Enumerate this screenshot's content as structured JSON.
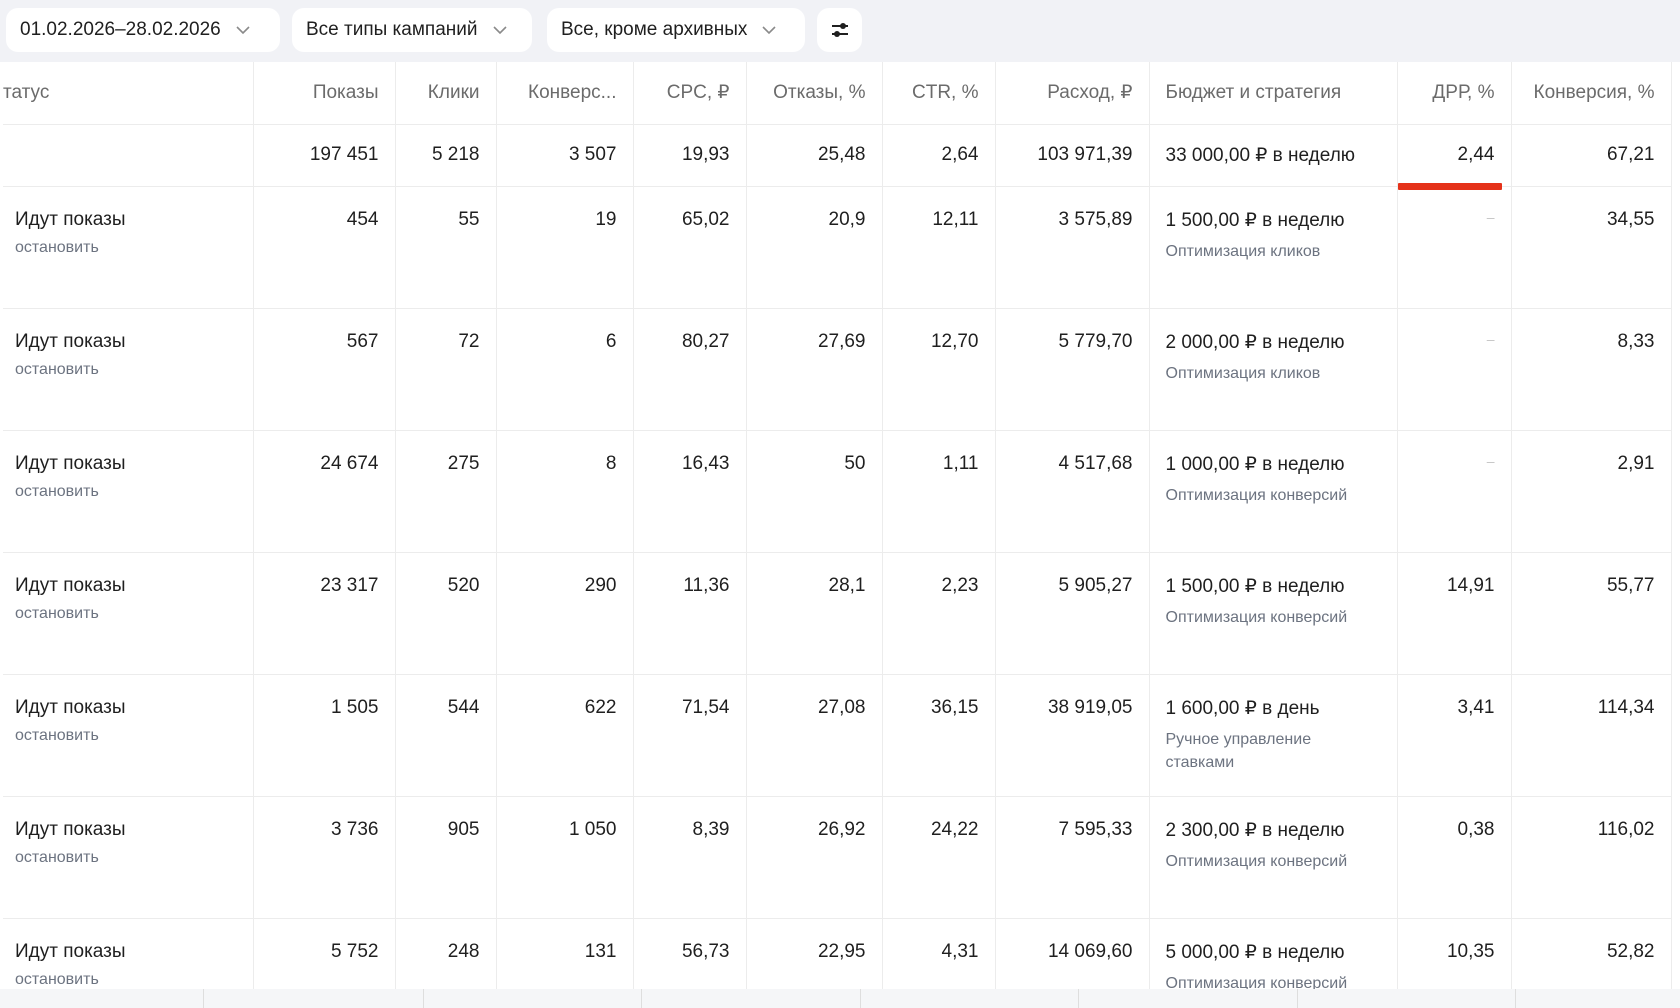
{
  "filters": {
    "date_range": "01.02.2026–28.02.2026",
    "campaign_types": "Все типы кампаний",
    "archive_filter": "Все, кроме архивных"
  },
  "columns": [
    "татус",
    "Показы",
    "Клики",
    "Конверс...",
    "CPC, ₽",
    "Отказы, %",
    "CTR, %",
    "Расход, ₽",
    "Бюджет и стратегия",
    "ДРР, %",
    "Конверсия, %"
  ],
  "totals": {
    "impressions": "197 451",
    "clicks": "5 218",
    "conversions": "3 507",
    "cpc": "19,93",
    "bounces": "25,48",
    "ctr": "2,64",
    "spend": "103 971,39",
    "budget": "33 000,00 ₽ в неделю",
    "drr": "2,44",
    "conv_rate": "67,21"
  },
  "rows": [
    {
      "status": "Идут показы",
      "action": "остановить",
      "impressions": "454",
      "clicks": "55",
      "conversions": "19",
      "cpc": "65,02",
      "bounces": "20,9",
      "ctr": "12,11",
      "spend": "3 575,89",
      "budget": "1 500,00 ₽ в неделю",
      "strategy": "Оптимизация кликов",
      "drr": "–",
      "conv_rate": "34,55"
    },
    {
      "status": "Идут показы",
      "action": "остановить",
      "impressions": "567",
      "clicks": "72",
      "conversions": "6",
      "cpc": "80,27",
      "bounces": "27,69",
      "ctr": "12,70",
      "spend": "5 779,70",
      "budget": "2 000,00 ₽ в неделю",
      "strategy": "Оптимизация кликов",
      "drr": "–",
      "conv_rate": "8,33"
    },
    {
      "status": "Идут показы",
      "action": "остановить",
      "impressions": "24 674",
      "clicks": "275",
      "conversions": "8",
      "cpc": "16,43",
      "bounces": "50",
      "ctr": "1,11",
      "spend": "4 517,68",
      "budget": "1 000,00 ₽ в неделю",
      "strategy": "Оптимизация конверсий",
      "drr": "–",
      "conv_rate": "2,91"
    },
    {
      "status": "Идут показы",
      "action": "остановить",
      "impressions": "23 317",
      "clicks": "520",
      "conversions": "290",
      "cpc": "11,36",
      "bounces": "28,1",
      "ctr": "2,23",
      "spend": "5 905,27",
      "budget": "1 500,00 ₽ в неделю",
      "strategy": "Оптимизация конверсий",
      "drr": "14,91",
      "conv_rate": "55,77"
    },
    {
      "status": "Идут показы",
      "action": "остановить",
      "impressions": "1 505",
      "clicks": "544",
      "conversions": "622",
      "cpc": "71,54",
      "bounces": "27,08",
      "ctr": "36,15",
      "spend": "38 919,05",
      "budget": "1 600,00 ₽ в день",
      "strategy": "Ручное управление ставками",
      "drr": "3,41",
      "conv_rate": "114,34"
    },
    {
      "status": "Идут показы",
      "action": "остановить",
      "impressions": "3 736",
      "clicks": "905",
      "conversions": "1 050",
      "cpc": "8,39",
      "bounces": "26,92",
      "ctr": "24,22",
      "spend": "7 595,33",
      "budget": "2 300,00 ₽ в неделю",
      "strategy": "Оптимизация конверсий",
      "drr": "0,38",
      "conv_rate": "116,02"
    },
    {
      "status": "Идут показы",
      "action": "остановить",
      "impressions": "5 752",
      "clicks": "248",
      "conversions": "131",
      "cpc": "56,73",
      "bounces": "22,95",
      "ctr": "4,31",
      "spend": "14 069,60",
      "budget": "5 000,00 ₽ в неделю",
      "strategy": "Оптимизация конверсий",
      "drr": "10,35",
      "conv_rate": "52,82"
    }
  ],
  "colors": {
    "highlight": "#e5321a",
    "toolbar_bg": "#f1f2f6",
    "muted_text": "#6c7380"
  }
}
